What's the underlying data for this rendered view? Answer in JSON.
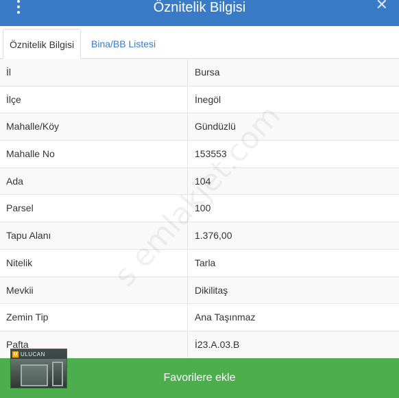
{
  "header": {
    "title": "Öznitelik Bilgisi",
    "menu_icon": "kebab-menu-icon",
    "close_icon": "close-icon",
    "close_glyph": "✕"
  },
  "tabs": [
    {
      "label": "Öznitelik Bilgisi",
      "active": true
    },
    {
      "label": "Bina/BB Listesi",
      "active": false
    }
  ],
  "attributes": [
    {
      "key": "İl",
      "value": "Bursa"
    },
    {
      "key": "İlçe",
      "value": "İnegöl"
    },
    {
      "key": "Mahalle/Köy",
      "value": "Gündüzlü"
    },
    {
      "key": "Mahalle No",
      "value": "153553"
    },
    {
      "key": "Ada",
      "value": "104"
    },
    {
      "key": "Parsel",
      "value": "100"
    },
    {
      "key": "Tapu Alanı",
      "value": "1.376,00"
    },
    {
      "key": "Nitelik",
      "value": "Tarla"
    },
    {
      "key": "Mevkii",
      "value": "Dikilitaş"
    },
    {
      "key": "Zemin Tip",
      "value": "Ana Taşınmaz"
    },
    {
      "key": "Pafta",
      "value": "İ23.A.03.B"
    }
  ],
  "watermark": "s emlakjet.com",
  "logo": {
    "badge": "U",
    "text": "ULUCAN"
  },
  "footer": {
    "favorite_label": "Favorilere ekle"
  },
  "colors": {
    "header": "#3a7bc8",
    "button": "#4cae4c",
    "tab_link": "#3a7bc8"
  }
}
